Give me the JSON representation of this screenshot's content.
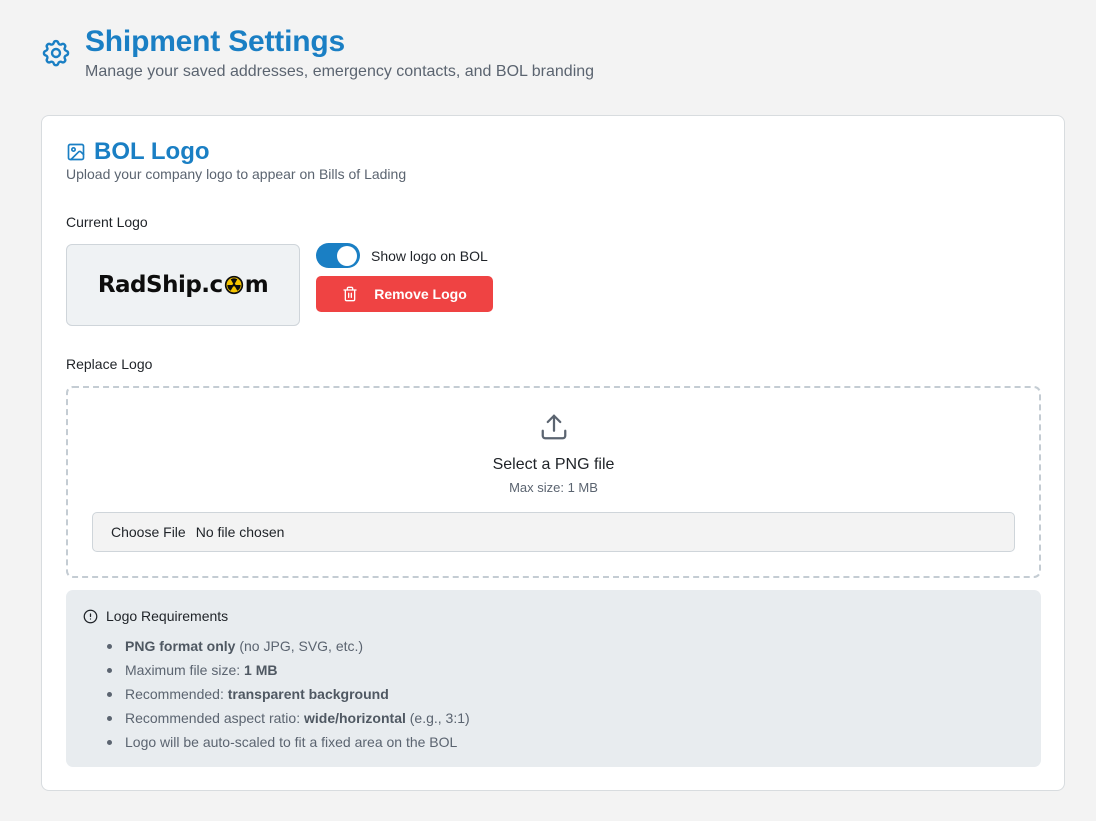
{
  "header": {
    "title": "Shipment Settings",
    "subtitle": "Manage your saved addresses, emergency contacts, and BOL branding"
  },
  "section": {
    "title": "BOL Logo",
    "description": "Upload your company logo to appear on Bills of Lading",
    "current_logo_label": "Current Logo",
    "logo_text_left": "RadShip.c",
    "logo_text_right": "m",
    "show_logo_label": "Show logo on BOL",
    "show_logo_enabled": true,
    "remove_button_label": "Remove Logo",
    "replace_logo_label": "Replace Logo",
    "dropzone": {
      "title": "Select a PNG file",
      "subtitle": "Max size: 1 MB",
      "choose_file_label": "Choose File",
      "file_status": "No file chosen"
    },
    "requirements": {
      "title": "Logo Requirements",
      "items": [
        {
          "strong": "PNG format only",
          "rest": " (no JPG, SVG, etc.)"
        },
        {
          "prefix": "Maximum file size: ",
          "strong": "1 MB"
        },
        {
          "prefix": "Recommended: ",
          "strong": "transparent background"
        },
        {
          "prefix": "Recommended aspect ratio: ",
          "strong": "wide/horizontal",
          "rest": " (e.g., 3:1)"
        },
        {
          "prefix": "Logo will be auto-scaled to fit a fixed area on the BOL"
        }
      ]
    }
  },
  "colors": {
    "accent": "#1a7fc4",
    "danger": "#ef4343",
    "background": "#f3f3f3"
  },
  "icons": {
    "header": "gear-icon",
    "section": "image-icon",
    "remove": "trash-icon",
    "upload": "upload-icon",
    "requirements": "info-circle-icon"
  }
}
